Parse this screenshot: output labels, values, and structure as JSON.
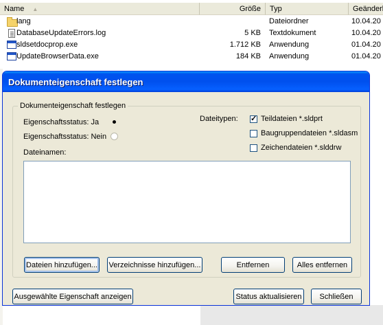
{
  "explorer": {
    "columns": {
      "name": "Name",
      "size": "Größe",
      "type": "Typ",
      "date": "Geänderl"
    },
    "files": [
      {
        "icon": "folder-icon",
        "name": "lang",
        "size": "",
        "type": "Dateiordner",
        "date": "10.04.20"
      },
      {
        "icon": "text-document-icon",
        "name": "DatabaseUpdateErrors.log",
        "size": "5 KB",
        "type": "Textdokument",
        "date": "10.04.20"
      },
      {
        "icon": "application-icon",
        "name": "sldsetdocprop.exe",
        "size": "1.712 KB",
        "type": "Anwendung",
        "date": "01.04.20"
      },
      {
        "icon": "application-icon",
        "name": "UpdateBrowserData.exe",
        "size": "184 KB",
        "type": "Anwendung",
        "date": "01.04.20"
      }
    ]
  },
  "dialog": {
    "title": "Dokumenteigenschaft festlegen",
    "group_title": "Dokumenteigenschaft festlegen",
    "status_yes_label": "Eigenschaftsstatus: Ja",
    "status_no_label": "Eigenschaftsstatus: Nein",
    "status_selected": "Ja",
    "filetypes_label": "Dateitypen:",
    "filetypes": [
      {
        "label": "Teildateien *.sldprt",
        "checked": true
      },
      {
        "label": "Baugruppendateien *.sldasm",
        "checked": false
      },
      {
        "label": "Zeichendateien *.slddrw",
        "checked": false
      }
    ],
    "filenames_label": "Dateinamen:",
    "buttons": {
      "add_files": "Dateien hinzufügen...",
      "add_folders": "Verzeichnisse hinzufügen...",
      "remove": "Entfernen",
      "remove_all": "Alles entfernen",
      "show_property": "Ausgewählte Eigenschaft anzeigen",
      "update_status": "Status aktualisieren",
      "close": "Schließen"
    }
  }
}
